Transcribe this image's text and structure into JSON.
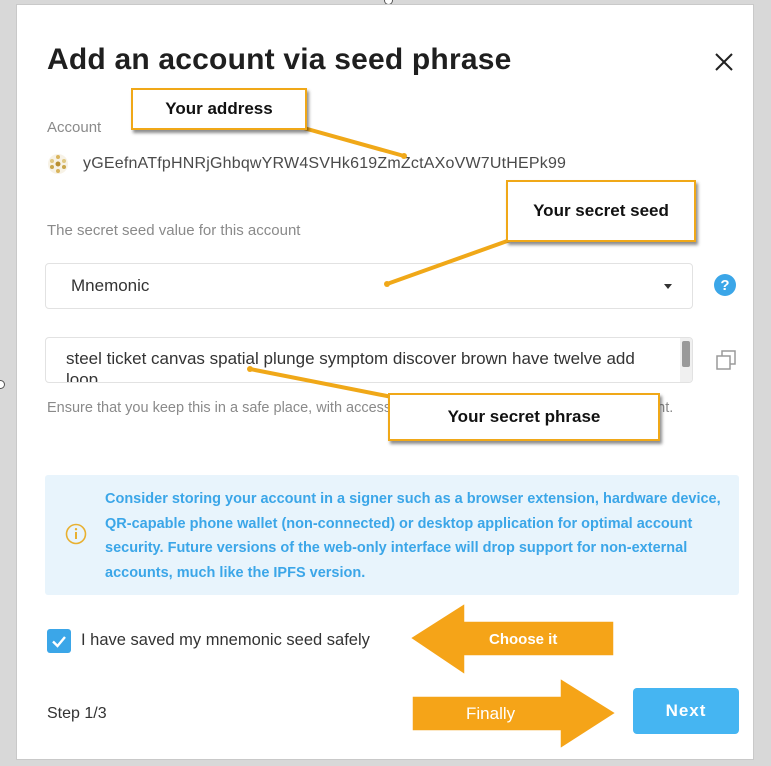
{
  "modal": {
    "title": "Add an account via seed phrase",
    "account_label": "Account",
    "address": "yGEefnATfpHNRjGhbqwYRW4SVHk619ZmZctAXoVW7UtHEPk99",
    "seed_label": "The secret seed value for this account",
    "seed_type": "Mnemonic",
    "seed_phrase": "steel ticket canvas spatial plunge symptom discover brown have twelve add loop",
    "warning": "Ensure that you keep this in a safe place, with access to it you will be able to recover the account.",
    "info_text": "Consider storing your account in a signer such as a browser extension, hardware device, QR-capable phone wallet (non-connected) or desktop application for optimal account security. Future versions of the web-only interface will drop support for non-external accounts, much like the IPFS version.",
    "confirm_label": "I have saved my mnemonic seed safely",
    "confirm_checked": true,
    "step": "Step 1/3",
    "next_label": "Next",
    "help_glyph": "?"
  },
  "annotations": {
    "address_callout": "Your address",
    "seed_callout": "Your secret seed",
    "phrase_callout": "Your secret phrase",
    "choose_arrow": "Choose it",
    "finally_arrow": "Finally"
  },
  "colors": {
    "accent": "#3ba6e8",
    "next_button": "#45b5f2",
    "callout_border": "#f0a818",
    "arrow_fill": "#f5a418",
    "info_bg": "#e8f4fc"
  },
  "icons": {
    "close": "close-icon",
    "identicon": "identicon-icon",
    "help": "help-icon",
    "copy": "copy-icon",
    "info": "info-icon",
    "check": "checkmark-icon",
    "caret": "caret-down-icon"
  }
}
